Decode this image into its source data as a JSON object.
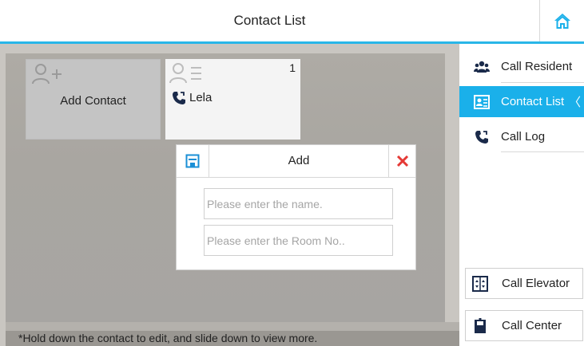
{
  "header": {
    "title": "Contact List"
  },
  "contacts": {
    "add_card_label": "Add Contact",
    "items": [
      {
        "index": "1",
        "name": "Lela"
      }
    ]
  },
  "dialog": {
    "title": "Add",
    "name_placeholder": "Please enter the name.",
    "room_placeholder": "Please enter the Room No.."
  },
  "sidebar": {
    "items": [
      {
        "label": "Call Resident",
        "icon": "residents-icon"
      },
      {
        "label": "Contact List",
        "icon": "contact-card-icon",
        "active": true,
        "chevron": "〈"
      },
      {
        "label": "Call Log",
        "icon": "call-log-icon"
      }
    ],
    "buttons": [
      {
        "label": "Call Elevator",
        "icon": "elevator-icon"
      },
      {
        "label": "Call Center",
        "icon": "call-center-icon"
      }
    ]
  },
  "hint": "*Hold down the contact to edit, and slide down to view more.",
  "colors": {
    "accent": "#1ab0ea",
    "close": "#e53935",
    "save": "#1a8fd6"
  }
}
